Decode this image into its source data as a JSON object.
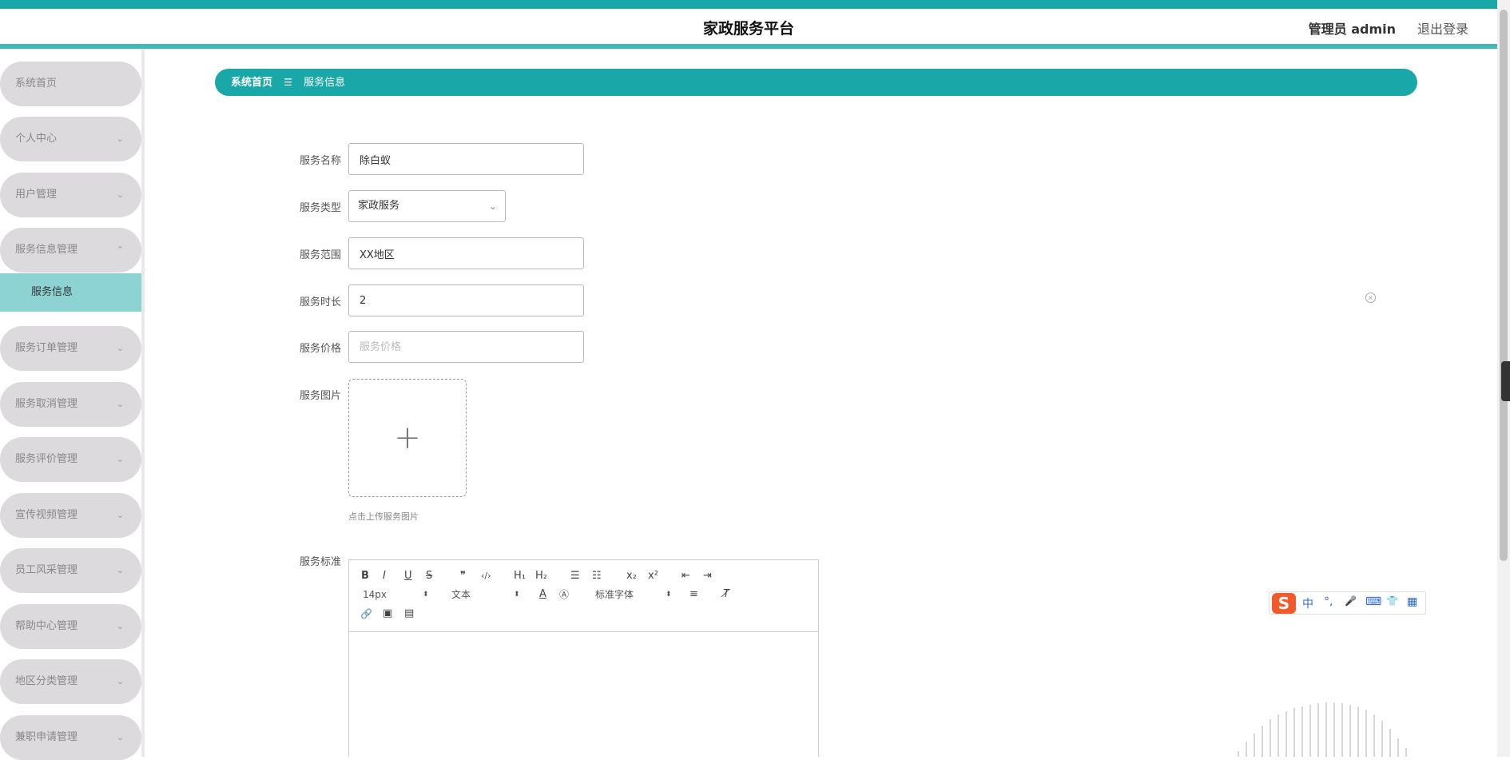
{
  "header": {
    "title": "家政服务平台",
    "user": "管理员 admin",
    "logout": "退出登录"
  },
  "sidebar": {
    "items": [
      {
        "label": "系统首页"
      },
      {
        "label": "个人中心"
      },
      {
        "label": "用户管理"
      },
      {
        "label": "服务信息管理"
      },
      {
        "label": "服务订单管理"
      },
      {
        "label": "服务取消管理"
      },
      {
        "label": "服务评价管理"
      },
      {
        "label": "宣传视频管理"
      },
      {
        "label": "员工风采管理"
      },
      {
        "label": "帮助中心管理"
      },
      {
        "label": "地区分类管理"
      },
      {
        "label": "兼职申请管理"
      }
    ],
    "submenu_active": "服务信息",
    "chevron_down": "⌄",
    "chevron_up": "⌃"
  },
  "breadcrumb": {
    "home": "系统首页",
    "separator": "☰",
    "current": "服务信息"
  },
  "form": {
    "name": {
      "label": "服务名称",
      "value": "除白蚁"
    },
    "type": {
      "label": "服务类型",
      "value": "家政服务"
    },
    "range": {
      "label": "服务范围",
      "value": "XX地区"
    },
    "duration": {
      "label": "服务时长",
      "value": "2"
    },
    "price": {
      "label": "服务价格",
      "placeholder": "服务价格"
    },
    "image": {
      "label": "服务图片",
      "hint": "点击上传服务图片",
      "plus": "+"
    },
    "standard": {
      "label": "服务标准"
    }
  },
  "editor": {
    "font_size": "14px",
    "text_type": "文本",
    "font_family": "标准字体",
    "buttons": {
      "bold": "B",
      "italic": "I",
      "underline": "U",
      "strike": "S",
      "quote": "❞",
      "code": "‹/›",
      "h1": "H₁",
      "h2": "H₂",
      "ol": "☰",
      "ul": "☷",
      "sub": "x₂",
      "sup": "x²",
      "outdent": "⇤",
      "indent": "⇥",
      "color": "A",
      "bg": "Ⓐ",
      "align": "≡",
      "clear": "T̸",
      "link": "🔗",
      "image": "▣",
      "video": "▤"
    }
  },
  "ime": {
    "logo": "S",
    "items": [
      "中",
      "°,",
      "🎤",
      "⌨",
      "👕",
      "▦"
    ]
  },
  "colors": {
    "accent": "#19a7a7",
    "accent_light": "#8ed3d3",
    "menu_bg": "#dcdadc"
  }
}
